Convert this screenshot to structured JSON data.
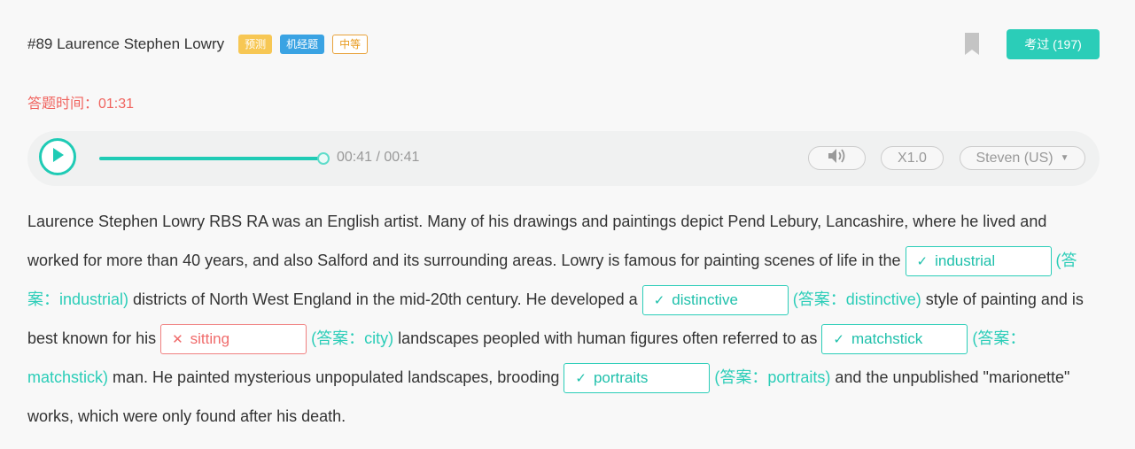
{
  "header": {
    "title": "#89 Laurence Stephen Lowry",
    "tags": [
      "预测",
      "机经题",
      "中等"
    ],
    "pass_label": "考过 (197)"
  },
  "timer": "答题时间：01:31",
  "player": {
    "progress": 1.0,
    "time": "00:41 / 00:41",
    "speed": "X1.0",
    "voice": "Steven (US)"
  },
  "passage": {
    "p0": "Laurence Stephen Lowry RBS RA was an English artist. Many of his drawings and paintings depict Pend Lebury, Lancashire, where he lived and worked for more than 40 years, and also Salford and its surrounding areas. Lowry is famous for painting scenes of life in the ",
    "blank1": {
      "mark": "✓",
      "value": "industrial",
      "answer": "(答案：industrial)"
    },
    "p1": " districts of North West England in the mid-20th century. He developed a ",
    "blank2": {
      "mark": "✓",
      "value": "distinctive",
      "answer": "(答案：distinctive)"
    },
    "p2": " style of painting and is best known for his ",
    "blank3": {
      "mark": "✕",
      "value": "sitting",
      "answer": "(答案：city)"
    },
    "p3": " landscapes peopled with human figures often referred to as ",
    "blank4": {
      "mark": "✓",
      "value": "matchstick",
      "answer": "(答案：matchstick)"
    },
    "p4": " man. He painted mysterious unpopulated landscapes, brooding ",
    "blank5": {
      "mark": "✓",
      "value": "portraits",
      "answer": "(答案：portraits)"
    },
    "p5": " and the unpublished \"marionette\" works, which were only found after his death."
  },
  "colors": {
    "accent": "#2bcdb8",
    "error": "#f06b6b",
    "timer": "#f0645f",
    "tag_predict": "#f7c754",
    "tag_machine": "#3aa3e3",
    "tag_level": "#e8a23a"
  },
  "icons": [
    "bookmark-icon",
    "play-icon",
    "volume-icon",
    "caret-down-icon",
    "check-icon",
    "cross-icon"
  ]
}
